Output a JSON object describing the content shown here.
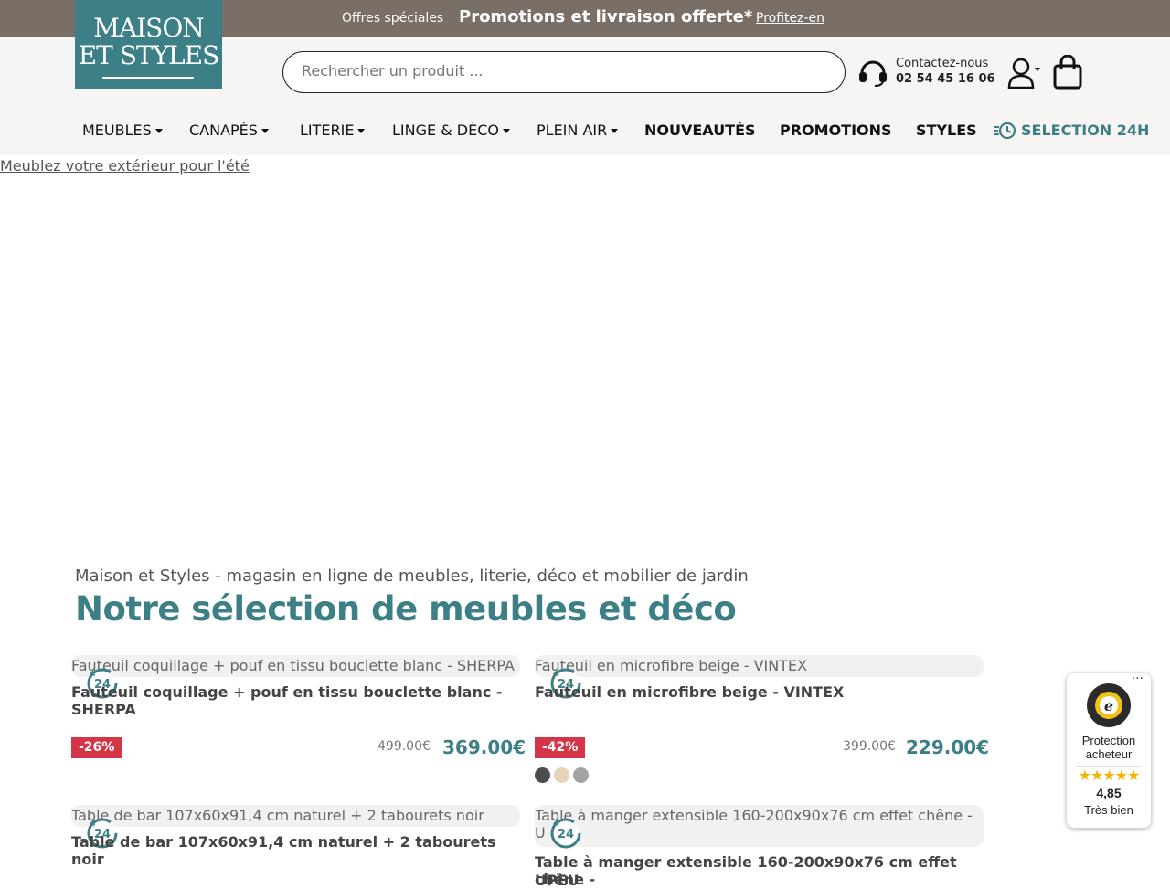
{
  "promo": {
    "small_text": "Offres spéciales",
    "headline": "Promotions et livraison offerte*",
    "cta": "Profitez-en"
  },
  "logo": {
    "line1": "MAISON",
    "line2": "ET STYLES"
  },
  "search": {
    "placeholder": "Rechercher un produit ..."
  },
  "contact": {
    "label": "Contactez-nous",
    "phone": "02 54 45 16 06"
  },
  "nav": {
    "items": [
      {
        "label": "MEUBLES",
        "dropdown": true
      },
      {
        "label": "CANAPÉS",
        "dropdown": true
      },
      {
        "label": "LITERIE",
        "dropdown": true
      },
      {
        "label": "LINGE & DÉCO",
        "dropdown": true
      },
      {
        "label": "PLEIN AIR",
        "dropdown": true
      },
      {
        "label": "NOUVEAUTÉS",
        "dropdown": false
      },
      {
        "label": "PROMOTIONS",
        "dropdown": false
      },
      {
        "label": "STYLES",
        "dropdown": false
      },
      {
        "label": "SELECTION 24H",
        "dropdown": false
      }
    ]
  },
  "hero": {
    "alt": "Meublez votre extérieur pour l'été"
  },
  "intro": {
    "subtitle": "Maison et Styles - magasin en ligne de meubles, literie, déco et mobilier de jardin",
    "title": "Notre sélection de meubles et déco"
  },
  "products": [
    {
      "img_alt": "Fauteuil coquillage + pouf en tissu bouclette blanc - SHERPA",
      "name": "Fauteuil coquillage + pouf en tissu bouclette blanc - SHERPA",
      "discount": "-26%",
      "old_price": "499.00€",
      "price": "369.00€",
      "badge": "24"
    },
    {
      "img_alt": "Fauteuil en microfibre beige - VINTEX",
      "name": "Fauteuil en microfibre beige - VINTEX",
      "discount": "-42%",
      "old_price": "399.00€",
      "price": "229.00€",
      "badge": "24",
      "swatches": [
        "#4b4d52",
        "#e5d4b8",
        "#a3a3a3"
      ]
    },
    {
      "img_alt": "Table de bar 107x60x91,4 cm naturel + 2 tabourets noir",
      "name": "Table de bar 107x60x91,4 cm naturel + 2 tabourets noir",
      "badge": "24"
    },
    {
      "img_alt": "Table à manger extensible 160-200x90x76 cm effet chêne - U",
      "name": "Table à manger extensible 160-200x90x76 cm effet chêne -",
      "name_line2": "UPEU",
      "badge": "24"
    }
  ],
  "trusted_shops": {
    "protection": "Protection acheteur",
    "stars": "★★★★★",
    "score": "4,85",
    "label": "Très bien"
  },
  "colors": {
    "brand_teal": "#3d7f87",
    "promo_bar": "#7a6f66",
    "discount_red": "#d63447",
    "header_bg": "#f6f5f3"
  }
}
